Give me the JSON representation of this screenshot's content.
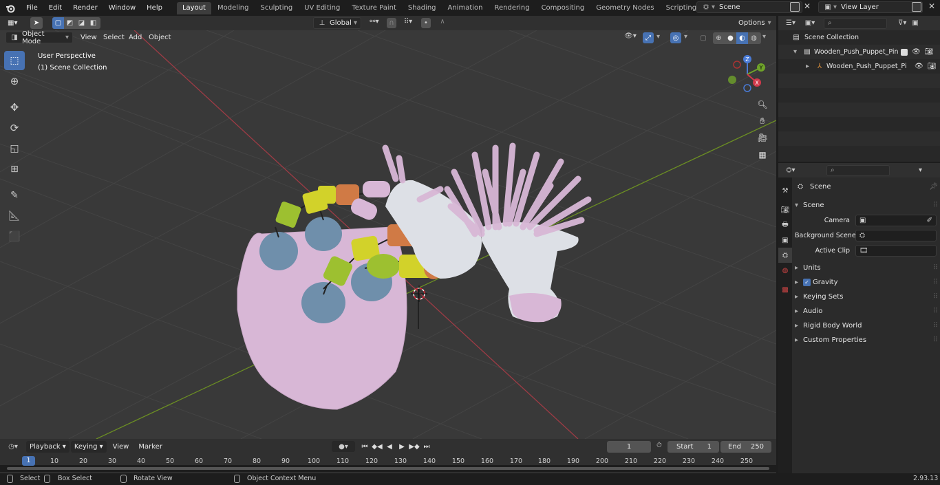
{
  "topbar": {
    "menus": [
      "File",
      "Edit",
      "Render",
      "Window",
      "Help"
    ],
    "workspaces": [
      "Layout",
      "Modeling",
      "Sculpting",
      "UV Editing",
      "Texture Paint",
      "Shading",
      "Animation",
      "Rendering",
      "Compositing",
      "Geometry Nodes",
      "Scripting"
    ],
    "active_workspace": "Layout",
    "scene_name": "Scene",
    "view_layer": "View Layer"
  },
  "viewport_header": {
    "orientation": "Global",
    "options": "Options",
    "mode": "Object Mode",
    "menus": [
      "View",
      "Select",
      "Add",
      "Object"
    ]
  },
  "viewport": {
    "perspective": "User Perspective",
    "collection": "(1) Scene Collection"
  },
  "gizmo": {
    "z": "Z",
    "y": "Y",
    "x": "X"
  },
  "outliner": {
    "root": "Scene Collection",
    "items": [
      {
        "label": "Wooden_Push_Puppet_Pink_L"
      },
      {
        "label": "Wooden_Push_Puppet_Pi"
      }
    ]
  },
  "properties": {
    "title": "Scene",
    "panel": "Scene",
    "camera_label": "Camera",
    "bg_scene_label": "Background Scene",
    "active_clip_label": "Active Clip",
    "sections": [
      "Units",
      "Gravity",
      "Keying Sets",
      "Audio",
      "Rigid Body World",
      "Custom Properties"
    ]
  },
  "timeline": {
    "menus": [
      "Playback",
      "Keying",
      "View",
      "Marker"
    ],
    "current_frame": "1",
    "start_label": "Start",
    "start": "1",
    "end_label": "End",
    "end": "250",
    "ruler": [
      "1",
      "10",
      "20",
      "30",
      "40",
      "50",
      "60",
      "70",
      "80",
      "90",
      "100",
      "110",
      "120",
      "130",
      "140",
      "150",
      "160",
      "170",
      "180",
      "190",
      "200",
      "210",
      "220",
      "230",
      "240",
      "250"
    ]
  },
  "statusbar": {
    "select": "Select",
    "box_select": "Box Select",
    "rotate": "Rotate View",
    "context": "Object Context Menu",
    "version": "2.93.13"
  },
  "colors": {
    "accent": "#4772b3",
    "x_axis": "#9e3b45",
    "y_axis": "#6b8e23",
    "pink": "#d8b7d6",
    "blue": "#6f8fab",
    "green": "#9dc030",
    "yellow": "#d2d22a",
    "orange": "#d07a45"
  }
}
